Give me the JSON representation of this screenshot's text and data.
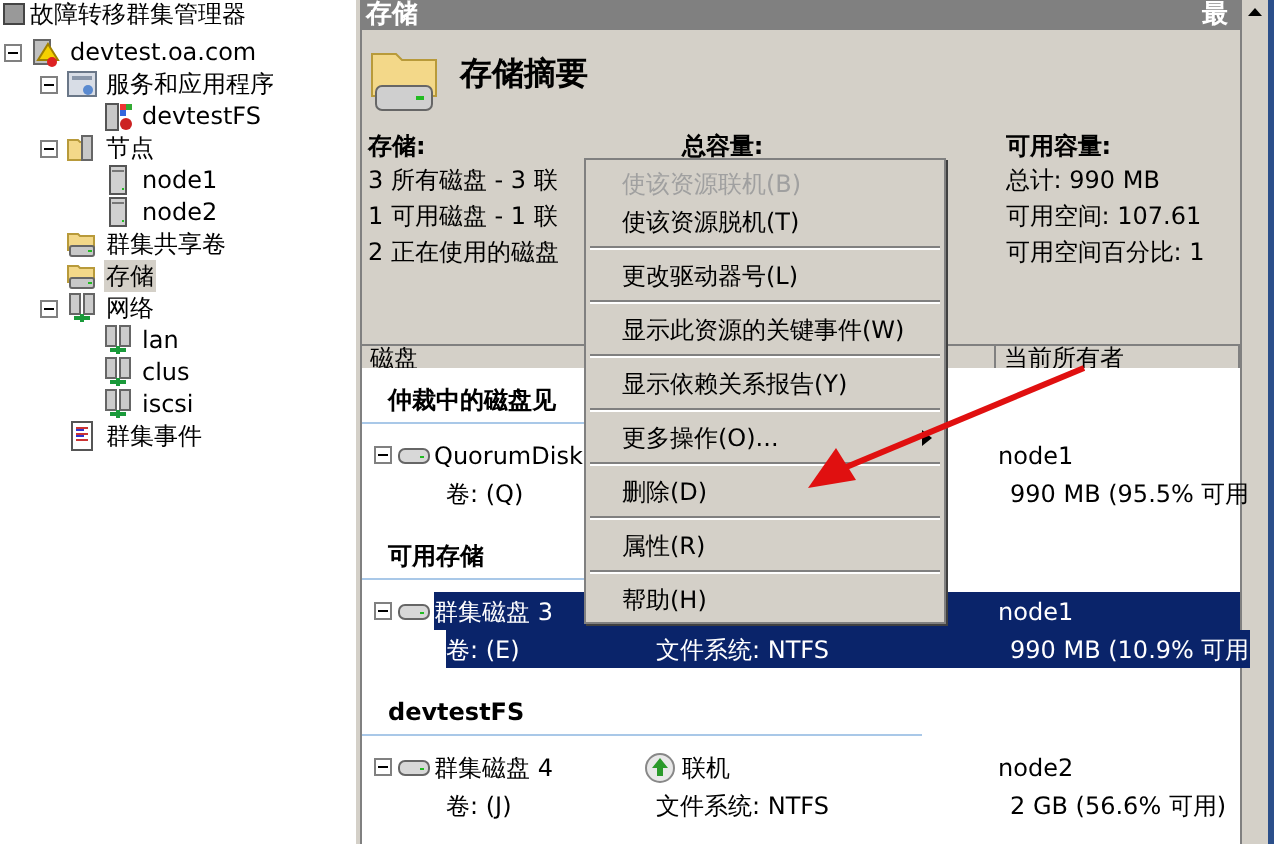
{
  "tree": {
    "title": "故障转移群集管理器",
    "items": [
      {
        "label": "devtest.oa.com",
        "kind": "cluster",
        "expanded": true,
        "selected": false,
        "children": [
          {
            "label": "服务和应用程序",
            "kind": "services",
            "expanded": true,
            "selected": false,
            "children": [
              {
                "label": "devtestFS",
                "kind": "app",
                "selected": false
              }
            ]
          },
          {
            "label": "节点",
            "kind": "folder",
            "expanded": true,
            "selected": false,
            "children": [
              {
                "label": "node1",
                "kind": "server",
                "selected": false
              },
              {
                "label": "node2",
                "kind": "server",
                "selected": false
              }
            ]
          },
          {
            "label": "群集共享卷",
            "kind": "storage",
            "selected": false
          },
          {
            "label": "存储",
            "kind": "storage",
            "selected": true
          },
          {
            "label": "网络",
            "kind": "network",
            "expanded": true,
            "selected": false,
            "children": [
              {
                "label": "lan",
                "kind": "network",
                "selected": false
              },
              {
                "label": "clus",
                "kind": "network",
                "selected": false
              },
              {
                "label": "iscsi",
                "kind": "network",
                "selected": false
              }
            ]
          },
          {
            "label": "群集事件",
            "kind": "events",
            "selected": false
          }
        ]
      }
    ]
  },
  "pane": {
    "title": "存储",
    "title_right": "最",
    "summary": {
      "heading": "存储摘要",
      "columns": [
        {
          "heading": "存储:",
          "lines": [
            "3 所有磁盘 - 3 联",
            "1 可用磁盘 - 1 联",
            "2 正在使用的磁盘"
          ]
        },
        {
          "heading": "总容量:"
        },
        {
          "heading": "可用容量:",
          "lines": [
            "总计: 990 MB",
            "可用空间: 107.61",
            "可用空间百分比: 1"
          ]
        }
      ]
    },
    "table": {
      "columns": [
        "磁盘",
        "",
        "当前所有者"
      ],
      "groups": [
        {
          "title": "仲裁中的磁盘见",
          "disks": [
            {
              "name": "QuorumDisk",
              "volume": "卷: (Q)",
              "owner": "node1",
              "capacity": "990 MB (95.5% 可用",
              "selected": false
            }
          ]
        },
        {
          "title": "可用存储",
          "disks": [
            {
              "name": "群集磁盘 3",
              "volume": "卷: (E)",
              "filesystem": "文件系统: NTFS",
              "owner": "node1",
              "capacity": "990 MB (10.9% 可用",
              "selected": true
            }
          ]
        },
        {
          "title": "devtestFS",
          "disks": [
            {
              "name": "群集磁盘 4",
              "status": "联机",
              "volume": "卷: (J)",
              "filesystem": "文件系统: NTFS",
              "owner": "node2",
              "capacity": "2 GB (56.6% 可用)",
              "selected": false
            }
          ]
        }
      ]
    }
  },
  "context_menu": [
    {
      "kind": "item",
      "label": "使该资源联机(B)",
      "disabled": true
    },
    {
      "kind": "item",
      "label": "使该资源脱机(T)",
      "disabled": false
    },
    {
      "kind": "separator"
    },
    {
      "kind": "item",
      "label": "更改驱动器号(L)",
      "disabled": false
    },
    {
      "kind": "separator"
    },
    {
      "kind": "item",
      "label": "显示此资源的关键事件(W)",
      "disabled": false
    },
    {
      "kind": "separator"
    },
    {
      "kind": "item",
      "label": "显示依赖关系报告(Y)",
      "disabled": false
    },
    {
      "kind": "separator"
    },
    {
      "kind": "submenu",
      "label": "更多操作(O)...",
      "disabled": false
    },
    {
      "kind": "separator"
    },
    {
      "kind": "item",
      "label": "删除(D)",
      "disabled": false
    },
    {
      "kind": "separator"
    },
    {
      "kind": "item",
      "label": "属性(R)",
      "disabled": false
    },
    {
      "kind": "separator"
    },
    {
      "kind": "item",
      "label": "帮助(H)",
      "disabled": false
    }
  ]
}
